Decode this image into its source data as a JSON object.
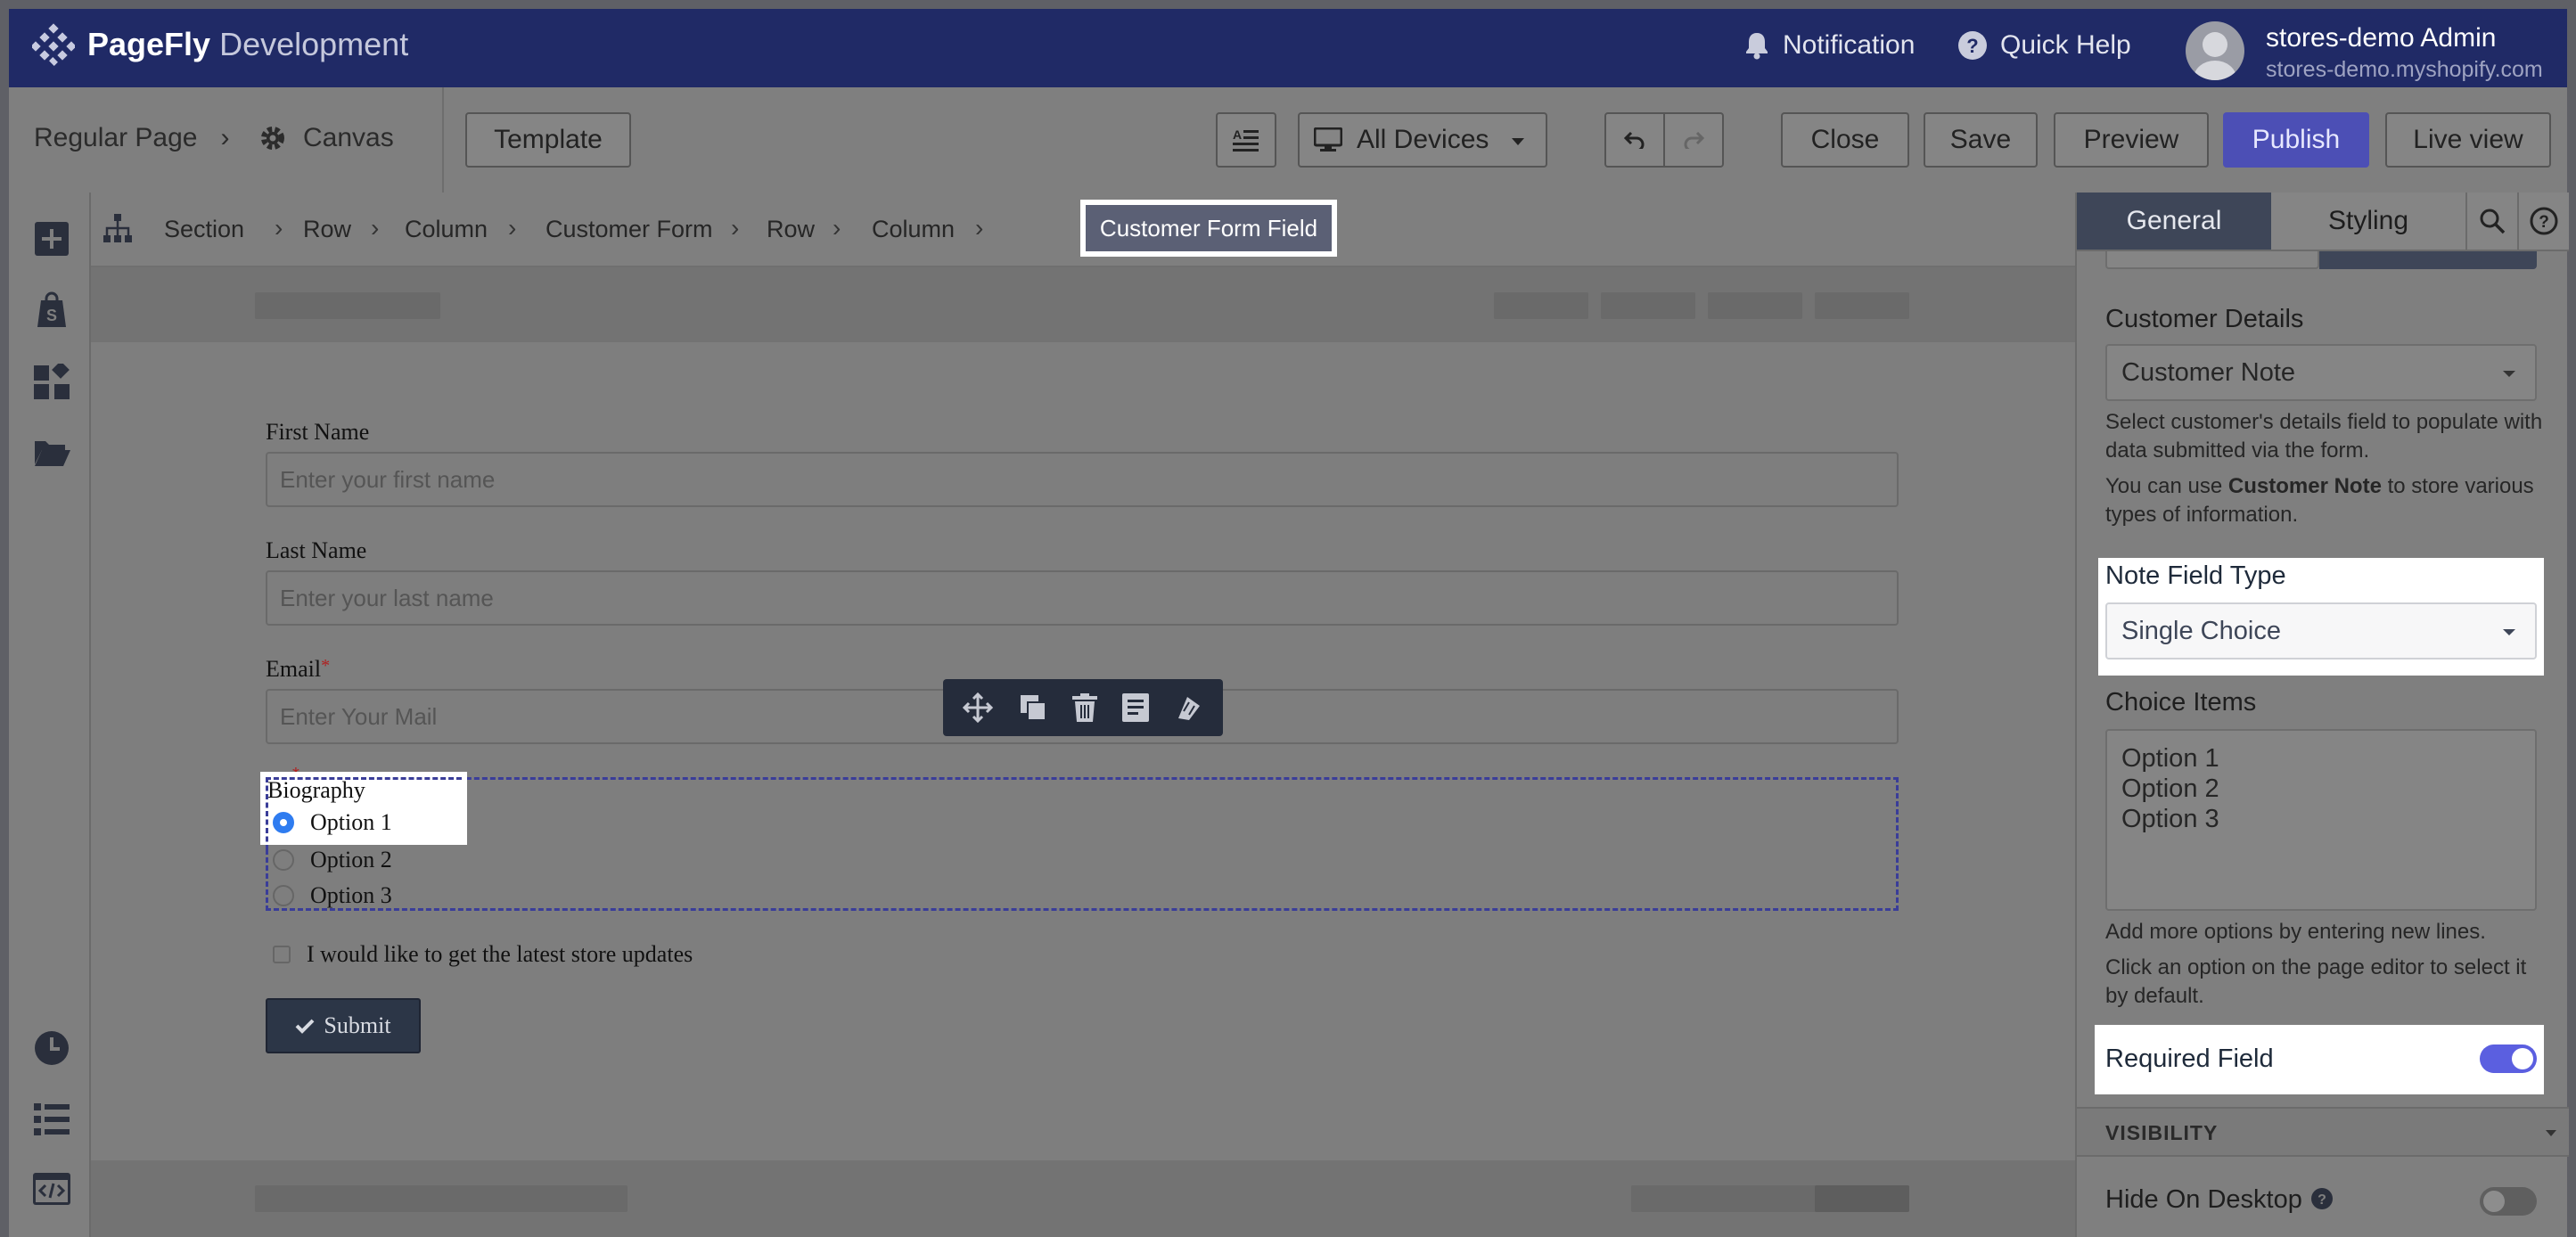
{
  "topnav": {
    "brand_bold": "PageFly",
    "brand_light": "Development",
    "notification": "Notification",
    "quick_help": "Quick Help",
    "user_name": "stores-demo Admin",
    "user_store": "stores-demo.myshopify.com"
  },
  "toolbar": {
    "regular_page": "Regular Page",
    "canvas": "Canvas",
    "template": "Template",
    "devices": "All Devices",
    "close": "Close",
    "save": "Save",
    "preview": "Preview",
    "publish": "Publish",
    "live_view": "Live view"
  },
  "breadcrumb": {
    "items": [
      "Section",
      "Row",
      "Column",
      "Customer Form",
      "Row",
      "Column"
    ],
    "active": "Customer Form Field"
  },
  "form": {
    "first_name_label": "First Name",
    "first_name_placeholder": "Enter your first name",
    "last_name_label": "Last Name",
    "last_name_placeholder": "Enter your last name",
    "email_label": "Email",
    "email_required": "*",
    "email_placeholder": "Enter Your Mail",
    "biography_label": "Biography",
    "biography_required": "*",
    "options": [
      "Option 1",
      "Option 2",
      "Option 3"
    ],
    "selected_option": "Option 1",
    "updates_label": "I would like to get the latest store updates",
    "submit": "Submit"
  },
  "panel": {
    "tab_general": "General",
    "tab_styling": "Styling",
    "customer_details_label": "Customer Details",
    "customer_details_value": "Customer Note",
    "help1": "Select customer's details field to populate with data submitted via the form.",
    "help2_pre": "You can use ",
    "help2_bold": "Customer Note",
    "help2_post": " to store various types of information.",
    "note_field_type_label": "Note Field Type",
    "note_field_type_value": "Single Choice",
    "choice_items_label": "Choice Items",
    "choice_items": "Option 1\nOption 2\nOption 3",
    "help3": "Add more options by entering new lines.",
    "help4": "Click an option on the page editor to select it by default.",
    "required_field_label": "Required Field",
    "required_field_on": true,
    "visibility": "VISIBILITY",
    "hide_on_desktop": "Hide On Desktop",
    "hide_on_desktop_on": false
  },
  "colors": {
    "nav_bg": "#202a66",
    "publish": "#4c4fb5",
    "toggle_on": "#5b5fe0",
    "radio_on": "#2f7cf0",
    "dashed_outline": "#3a3d99"
  }
}
